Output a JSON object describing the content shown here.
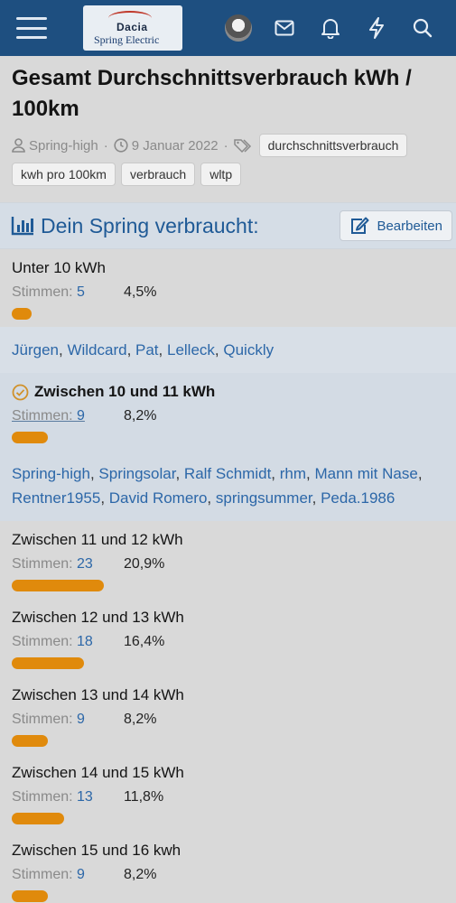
{
  "brand": {
    "line1": "Dacia",
    "line2": "Spring Electric"
  },
  "thread": {
    "title": "Gesamt Durchschnittsverbrauch kWh / 100km",
    "author": "Spring-high",
    "date": "9 Januar 2022",
    "tags": [
      "durchschnittsverbrauch",
      "kwh pro 100km",
      "verbrauch",
      "wltp"
    ]
  },
  "poll": {
    "title": "Dein Spring verbraucht:",
    "edit_label": "Bearbeiten",
    "votes_label": "Stimmen:",
    "options": [
      {
        "label": "Unter 10 kWh",
        "votes": "5",
        "percent": "4,5%",
        "fraction": 0.045,
        "voters": [
          "Jürgen",
          "Wildcard",
          "Pat",
          "Lelleck",
          "Quickly"
        ]
      },
      {
        "label": "Zwischen 10 und 11 kWh",
        "votes": "9",
        "percent": "8,2%",
        "fraction": 0.082,
        "selected": true,
        "voters": [
          "Spring-high",
          "Springsolar",
          "Ralf Schmidt",
          "rhm",
          "Mann mit Nase",
          "Rentner1955",
          "David Romero",
          "springsummer",
          "Peda.1986"
        ]
      },
      {
        "label": "Zwischen 11 und 12 kWh",
        "votes": "23",
        "percent": "20,9%",
        "fraction": 0.209
      },
      {
        "label": "Zwischen 12 und 13 kWh",
        "votes": "18",
        "percent": "16,4%",
        "fraction": 0.164
      },
      {
        "label": "Zwischen 13 und 14 kWh",
        "votes": "9",
        "percent": "8,2%",
        "fraction": 0.082
      },
      {
        "label": "Zwischen 14 und 15 kWh",
        "votes": "13",
        "percent": "11,8%",
        "fraction": 0.118
      },
      {
        "label": "Zwischen 15 und 16 kwh",
        "votes": "9",
        "percent": "8,2%",
        "fraction": 0.082
      }
    ]
  },
  "colors": {
    "header": "#1e4f80",
    "accent": "#2c67a8",
    "bar": "#e08a0c",
    "highlight": "#d3dbe4"
  },
  "icons": [
    "menu-icon",
    "avatar",
    "mail-icon",
    "bell-icon",
    "bolt-icon",
    "search-icon",
    "user-icon",
    "clock-icon",
    "tags-icon",
    "chart-icon",
    "edit-icon",
    "check-circle-icon"
  ]
}
